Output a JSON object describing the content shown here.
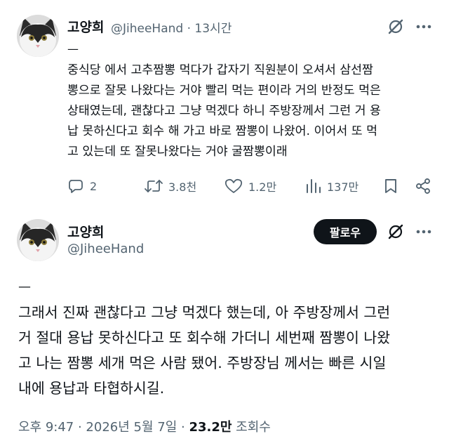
{
  "tweet1": {
    "name": "고양희",
    "handle": "@JiheeHand",
    "separator": "·",
    "time": "13시간",
    "dash": "—",
    "body_lines": [
      "중식당 에서 고추짬뽕 먹다가 갑자기 직원분이 오셔서 삼선짬",
      "뽕으로 잘못 나왔다는 거야 빨리 먹는 편이라 거의 반정도 먹은",
      "상태였는데, 괜찮다고 그냥 먹겠다 하니 주방장께서 그런 거 용",
      "납 못하신다고 회수 해 가고 바로 짬뽕이 나왔어. 이어서 또 먹",
      "고 있는데 또 잘못나왔다는 거야 굴짬뽕이래"
    ],
    "stats": {
      "replies": "2",
      "retweets": "3.8천",
      "likes": "1.2만",
      "views": "137만"
    }
  },
  "tweet2": {
    "name": "고양희",
    "handle": "@JiheeHand",
    "follow_label": "팔로우",
    "dash": "—",
    "body_lines": [
      "그래서 진짜 괜찮다고 그냥 먹겠다 했는데, 아 주방장께서 그런",
      "거 절대 용납 못하신다고 또 회수해 가더니 세번째 짬뽕이 나왔",
      "고 나는 짬뽕 세개 먹은 사람 됐어. 주방장님 께서는 빠른 시일",
      "내에 용납과 타협하시길."
    ],
    "footer": {
      "timestamp": "오후 9:47 · 2026년 5월 7일 ·",
      "views_count": "23.2만",
      "views_label": "조회수"
    }
  },
  "colors": {
    "text": "#0f1419",
    "secondary": "#536471",
    "button_bg": "#0f1419"
  },
  "icons": [
    "grok-icon",
    "more-icon",
    "reply-icon",
    "retweet-icon",
    "like-icon",
    "views-icon",
    "bookmark-icon",
    "share-icon"
  ]
}
